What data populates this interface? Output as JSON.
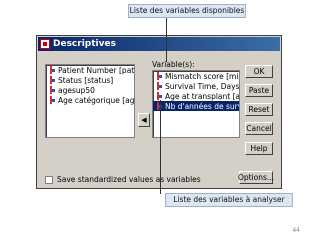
{
  "callouts": {
    "top": "Liste des variables disponibles",
    "bottom": "Liste des variables à analyser"
  },
  "window": {
    "title": "Descriptives"
  },
  "source_list": {
    "items": [
      {
        "label": "Patient Number [patnun",
        "selected": false
      },
      {
        "label": "Status [status]",
        "selected": false
      },
      {
        "label": "agesup50",
        "selected": false
      },
      {
        "label": "Age catégorique [agec:",
        "selected": false
      }
    ]
  },
  "target_list": {
    "label": "Variable(s):",
    "items": [
      {
        "label": "Mismatch score [misma",
        "selected": false
      },
      {
        "label": "Survival Time, Days [su",
        "selected": false
      },
      {
        "label": "Age at transplant [agetr",
        "selected": false
      },
      {
        "label": "Nb d'années de survie",
        "selected": true
      }
    ]
  },
  "buttons": {
    "ok": "OK",
    "paste": "Paste",
    "reset": "Reset",
    "cancel": "Cancel",
    "help": "Help",
    "options": "Options..."
  },
  "arrow_icon": "arrow-left-icon",
  "checkbox": {
    "label": "Save standardized values as variables",
    "checked": false
  },
  "page_number": "44"
}
